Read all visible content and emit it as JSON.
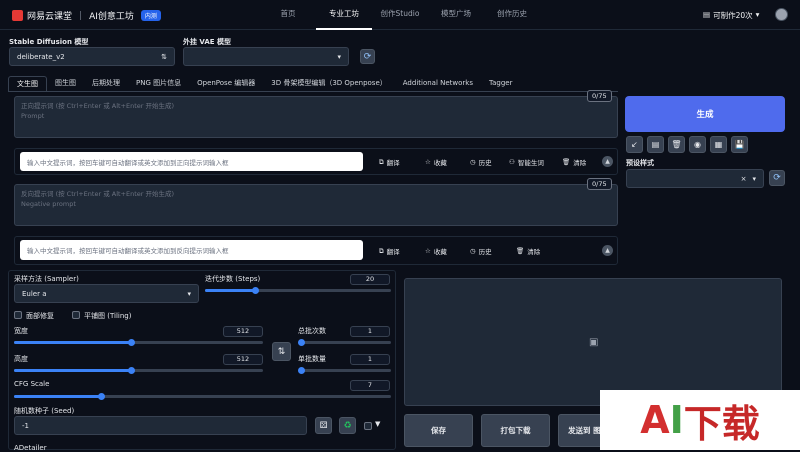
{
  "header": {
    "brand": "网易云课堂",
    "product": "AI创意工坊",
    "badge": "内测",
    "nav": [
      "首页",
      "专业工坊",
      "创作Studio",
      "模型广场",
      "创作历史"
    ],
    "active_nav": 1,
    "credits": "可制作20次",
    "credits_caret": "▾"
  },
  "model": {
    "label": "Stable Diffusion 模型",
    "value": "deliberate_v2",
    "swap_glyph": "⇅",
    "vae_label": "外挂 VAE 模型",
    "vae_value": "",
    "vae_caret": "▾"
  },
  "tabs": [
    "文生图",
    "图生图",
    "后期处理",
    "PNG 图片信息",
    "OpenPose 编辑器",
    "3D 骨架模型编辑（3D Openpose）",
    "Additional Networks",
    "Tagger"
  ],
  "prompt": {
    "placeholder_line1": "正向提示词 (按 Ctrl+Enter 或 Alt+Enter 开始生成)",
    "placeholder_line2": "Prompt",
    "counter": "0/75",
    "translate_placeholder": "输入中文提示词，按回车键可自动翻译或英文添加到正向提示词输入框",
    "buttons": [
      "翻译",
      "收藏",
      "历史",
      "智能生词",
      "清除"
    ]
  },
  "negative": {
    "placeholder_line1": "反向提示词 (按 Ctrl+Enter 或 Alt+Enter 开始生成)",
    "placeholder_line2": "Negative prompt",
    "counter": "0/75",
    "translate_placeholder": "输入中文提示词，按回车键可自动翻译或英文添加到反向提示词输入框",
    "buttons": [
      "翻译",
      "收藏",
      "历史",
      "清除"
    ]
  },
  "generate_label": "生成",
  "style": {
    "label": "预设样式",
    "clear_glyph": "×",
    "caret": "▾"
  },
  "params": {
    "sampler_label": "采样方法 (Sampler)",
    "sampler_value": "Euler a",
    "sampler_caret": "▾",
    "steps_label": "迭代步数 (Steps)",
    "steps_value": "20",
    "restore_faces_label": "面部修复",
    "tiling_label": "平铺图 (Tiling)",
    "width_label": "宽度",
    "width_value": "512",
    "height_label": "高度",
    "height_value": "512",
    "batch_count_label": "总批次数",
    "batch_count_value": "1",
    "batch_size_label": "单批数量",
    "batch_size_value": "1",
    "cfg_label": "CFG Scale",
    "cfg_value": "7",
    "seed_label": "随机数种子 (Seed)",
    "seed_value": "-1",
    "adetailer_label": "ADetailer"
  },
  "sliders": {
    "steps_fraction": 0.27,
    "width_fraction": 0.47,
    "height_fraction": 0.47,
    "batch_count_fraction": 0.0,
    "batch_size_fraction": 0.0,
    "cfg_fraction": 0.23
  },
  "actions": [
    "保存",
    "打包下载",
    "发送到 图"
  ],
  "watermark": {
    "a": "A",
    "i": "I",
    "rest": "下载"
  },
  "colors": {
    "accent": "#4f6bed",
    "slider": "#3b82f6"
  }
}
